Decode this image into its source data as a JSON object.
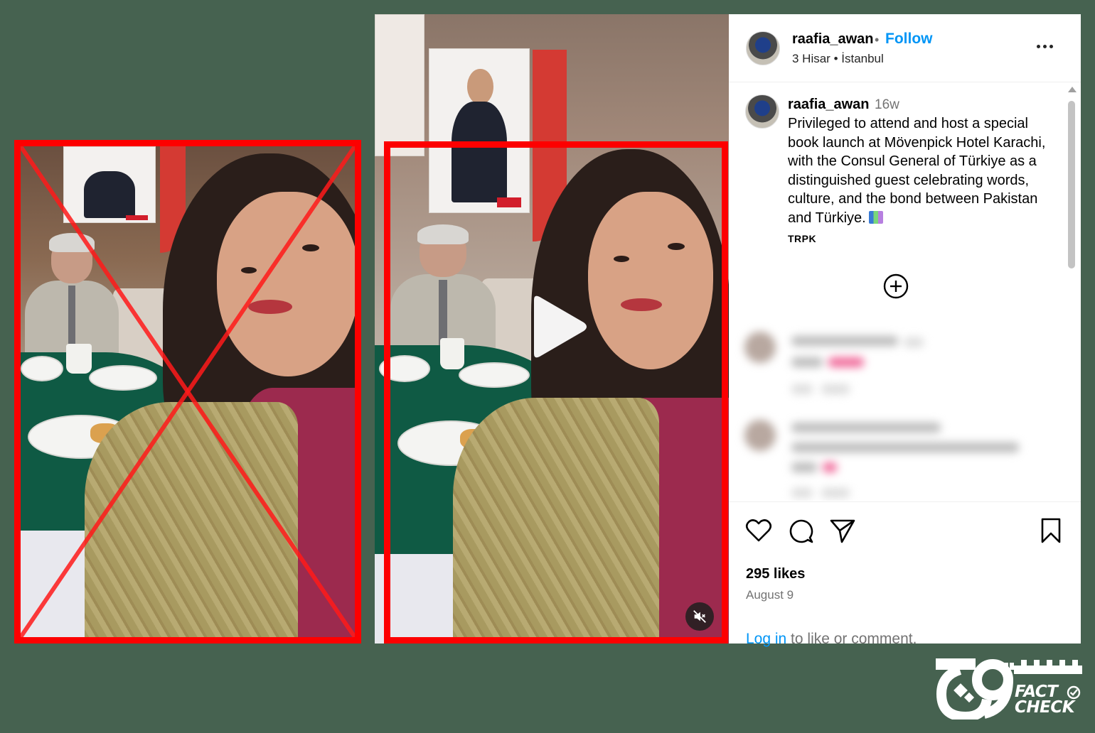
{
  "post": {
    "username": "raafia_awan",
    "separator": "•",
    "follow_label": "Follow",
    "location": "3 Hisar • İstanbul",
    "caption": {
      "username": "raafia_awan",
      "time": "16w",
      "text": "Privileged to attend and host a special book launch at Mövenpick Hotel Karachi, with the Consul General of Türkiye as a distinguished guest celebrating words, culture, and the bond between Pakistan and Türkiye.",
      "tag": "TRPK"
    },
    "likes": "295 likes",
    "date": "August 9",
    "login_link": "Log in",
    "login_rest": " to like or comment."
  },
  "icons": {
    "play": "play-icon",
    "mute": "muted-speaker-icon",
    "more": "more-options-icon",
    "load_more": "plus-circle-icon",
    "like": "heart-icon",
    "comment": "speech-bubble-icon",
    "share": "paper-plane-icon",
    "save": "bookmark-icon"
  },
  "colors": {
    "background": "#466250",
    "highlight_red": "#fd0000",
    "link_blue": "#0095f6",
    "meta_gray": "#737373"
  },
  "brand": {
    "line1": "FACT",
    "line2": "CHECK"
  }
}
